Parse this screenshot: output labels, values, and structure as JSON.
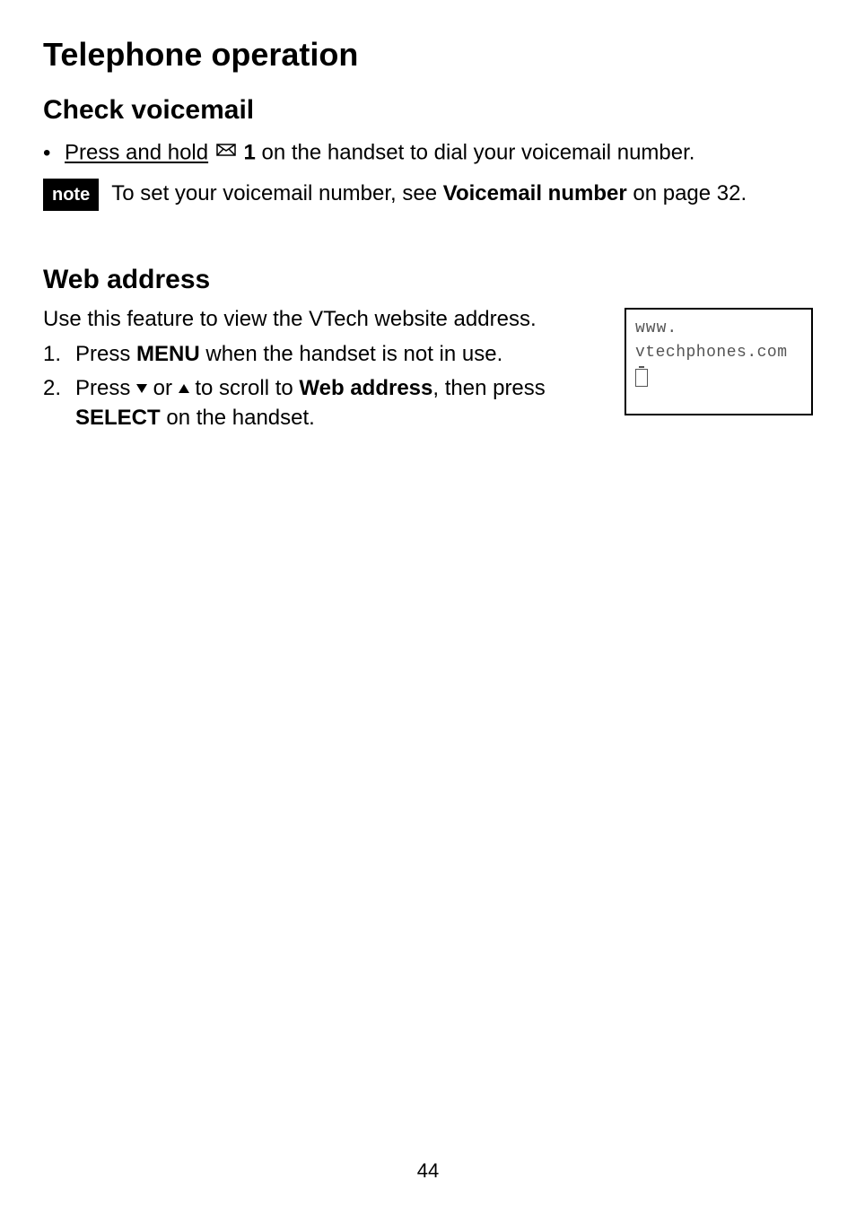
{
  "page": {
    "title": "Telephone operation",
    "number": "44"
  },
  "voicemail": {
    "heading": "Check voicemail",
    "bullet": "•",
    "line_before_underline": "Press and hold",
    "key": "1",
    "line_after": " on the handset to dial your voicemail number.",
    "note_badge": "note",
    "note_before": "To set your voicemail number, see ",
    "note_bold": "Voicemail number",
    "note_after": " on page 32."
  },
  "web": {
    "heading": "Web address",
    "intro": "Use this feature to view the VTech website address.",
    "step1_num": "1.",
    "step1_before": "Press ",
    "step1_bold": "MENU",
    "step1_after": " when the handset is not in use.",
    "step2_num": "2.",
    "step2_a": "Press ",
    "step2_b": " or ",
    "step2_c": " to scroll to ",
    "step2_bold1": "Web address",
    "step2_d": ", then press ",
    "step2_bold2": "SELECT",
    "step2_e": " on the handset."
  },
  "screen": {
    "line1": "www.",
    "line2": "vtechphones.com"
  }
}
